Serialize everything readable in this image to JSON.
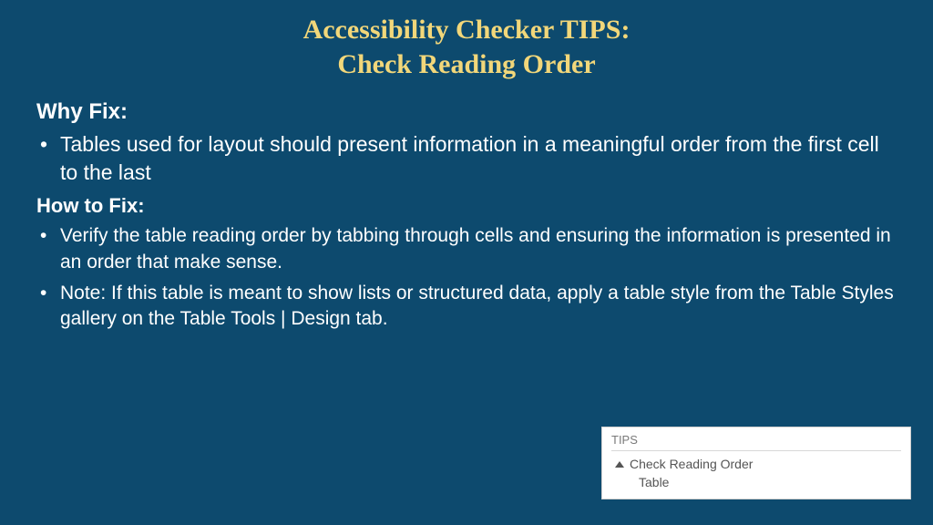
{
  "title": {
    "line1": "Accessibility Checker TIPS:",
    "line2": "Check Reading Order"
  },
  "sections": {
    "whyFix": {
      "heading": "Why Fix:",
      "items": [
        "Tables used for layout should present information in a meaningful order from the first cell to the last"
      ]
    },
    "howToFix": {
      "heading": "How to Fix:",
      "items": [
        "Verify the table reading order by tabbing through cells and ensuring the information is presented in an order that make sense.",
        "Note: If this table is meant to show lists or structured data, apply a table style from the Table Styles gallery on the Table Tools | Design tab."
      ]
    }
  },
  "tipsPanel": {
    "header": "TIPS",
    "item": "Check Reading Order",
    "subitem": "Table"
  }
}
